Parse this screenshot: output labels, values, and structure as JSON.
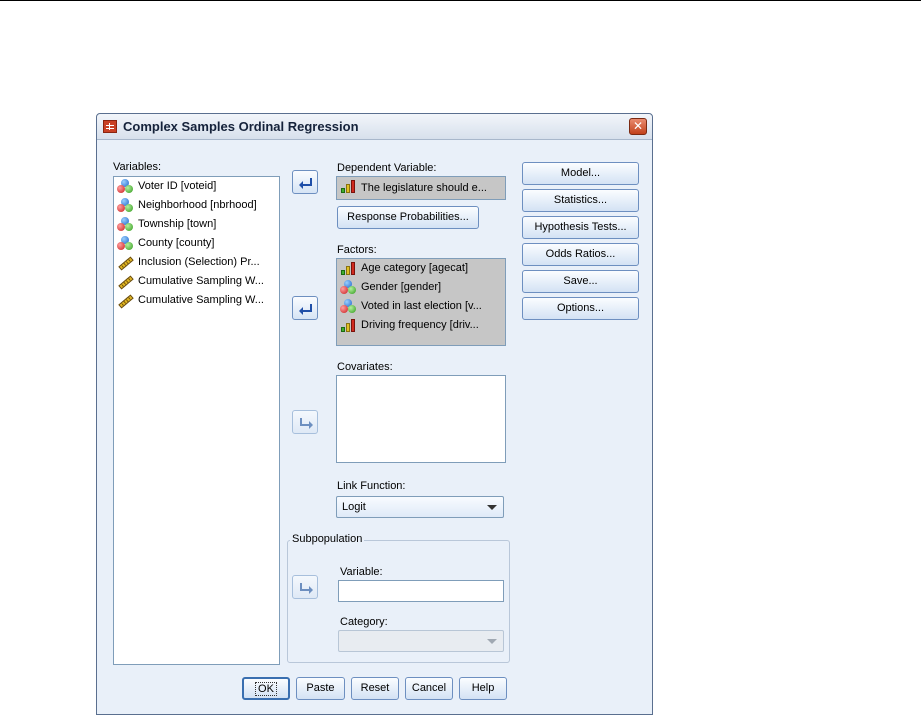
{
  "window": {
    "title": "Complex Samples Ordinal Regression",
    "close_glyph": "✕"
  },
  "variables": {
    "label": "Variables:",
    "items": [
      {
        "label": "Voter ID [voteid]",
        "type": "nominal"
      },
      {
        "label": "Neighborhood [nbrhood]",
        "type": "nominal"
      },
      {
        "label": "Township [town]",
        "type": "nominal"
      },
      {
        "label": "County [county]",
        "type": "nominal"
      },
      {
        "label": "Inclusion (Selection) Pr...",
        "type": "scale"
      },
      {
        "label": "Cumulative Sampling W...",
        "type": "scale"
      },
      {
        "label": "Cumulative Sampling W...",
        "type": "scale"
      }
    ]
  },
  "dependent": {
    "label": "Dependent Variable:",
    "value": "The legislature should e...",
    "type": "ordinal",
    "response_button": "Response Probabilities..."
  },
  "factors": {
    "label": "Factors:",
    "items": [
      {
        "label": "Age category [agecat]",
        "type": "ordinal"
      },
      {
        "label": "Gender [gender]",
        "type": "nominal"
      },
      {
        "label": "Voted in last election [v...",
        "type": "nominal"
      },
      {
        "label": "Driving frequency [driv...",
        "type": "ordinal"
      }
    ]
  },
  "covariates": {
    "label": "Covariates:"
  },
  "link": {
    "label": "Link Function:",
    "value": "Logit"
  },
  "subpopulation": {
    "label": "Subpopulation",
    "variable_label": "Variable:",
    "variable_value": "",
    "category_label": "Category:",
    "category_value": ""
  },
  "side_buttons": [
    "Model...",
    "Statistics...",
    "Hypothesis Tests...",
    "Odds Ratios...",
    "Save...",
    "Options..."
  ],
  "bottom_buttons": {
    "ok": "OK",
    "paste": "Paste",
    "reset": "Reset",
    "cancel": "Cancel",
    "help": "Help"
  }
}
